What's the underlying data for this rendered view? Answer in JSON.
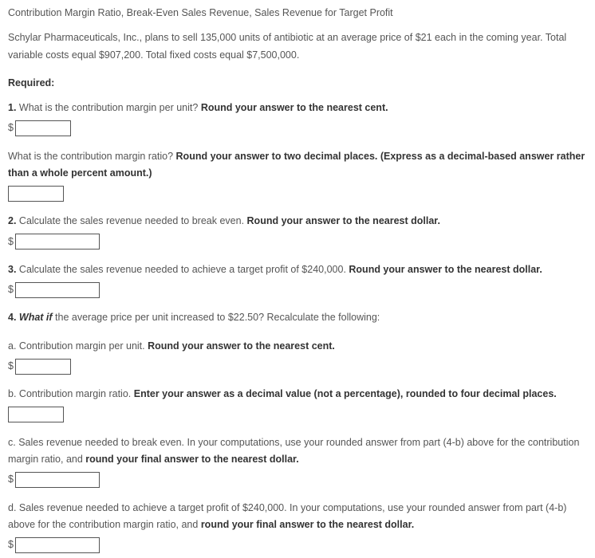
{
  "title": "Contribution Margin Ratio, Break-Even Sales Revenue, Sales Revenue for Target Profit",
  "problem": "Schylar Pharmaceuticals, Inc., plans to sell 135,000 units of antibiotic at an average price of $21 each in the coming year. Total variable costs equal $907,200. Total fixed costs equal $7,500,000.",
  "required_label": "Required:",
  "q1": {
    "num": "1.",
    "text": " What is the contribution margin per unit? ",
    "bold": "Round your answer to the nearest cent.",
    "prefix": "$"
  },
  "q1b": {
    "text": "What is the contribution margin ratio? ",
    "bold": "Round your answer to two decimal places. (Express as a decimal-based answer rather than a whole percent amount.)"
  },
  "q2": {
    "num": "2.",
    "text": " Calculate the sales revenue needed to break even. ",
    "bold": "Round your answer to the nearest dollar.",
    "prefix": "$"
  },
  "q3": {
    "num": "3.",
    "text": " Calculate the sales revenue needed to achieve a target profit of $240,000. ",
    "bold": "Round your answer to the nearest dollar.",
    "prefix": "$"
  },
  "q4": {
    "num": "4.",
    "whatif": " What if",
    "text": " the average price per unit increased to $22.50? Recalculate the following:"
  },
  "q4a": {
    "num": "a.",
    "text": "  Contribution margin per unit. ",
    "bold": "Round your answer to the nearest cent.",
    "prefix": "$"
  },
  "q4b": {
    "num": "b.",
    "text": "  Contribution margin ratio. ",
    "bold": "Enter your answer as a decimal value (not a percentage), rounded to four decimal places."
  },
  "q4c": {
    "num": "c.",
    "text": "  Sales revenue needed to break even. In your computations, use your rounded answer from part (4-b) above for the contribution margin ratio, and ",
    "bold": "round your final answer to the nearest dollar.",
    "prefix": "$"
  },
  "q4d": {
    "num": "d.",
    "text": "  Sales revenue needed to achieve a target profit of $240,000. In your computations, use your rounded answer from part (4-b) above for the contribution margin ratio, and ",
    "bold": "round your final answer to the nearest dollar.",
    "prefix": "$"
  }
}
